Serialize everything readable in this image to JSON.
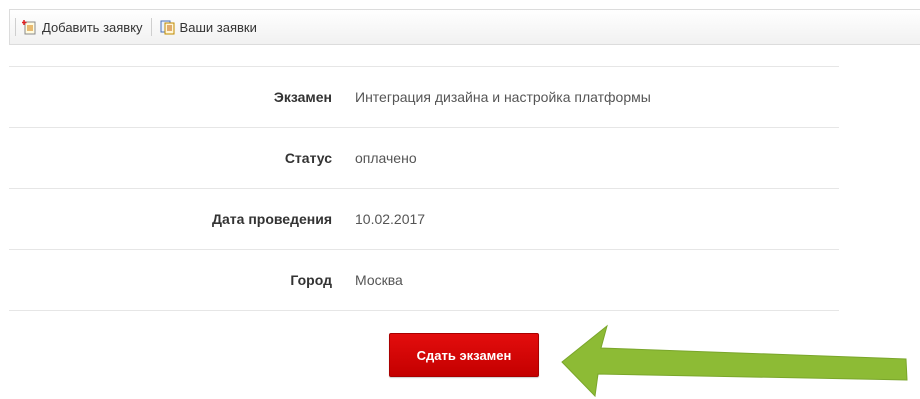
{
  "toolbar": {
    "add_request_label": "Добавить заявку",
    "your_requests_label": "Ваши заявки",
    "add_request_icon": "add-document-icon",
    "your_requests_icon": "document-list-icon"
  },
  "details": {
    "rows": [
      {
        "label": "Экзамен",
        "value": "Интеграция дизайна и настройка платформы"
      },
      {
        "label": "Статус",
        "value": "оплачено"
      },
      {
        "label": "Дата проведения",
        "value": "10.02.2017"
      },
      {
        "label": "Город",
        "value": "Москва"
      }
    ]
  },
  "actions": {
    "submit_label": "Сдать экзамен"
  },
  "colors": {
    "button": "#d40000",
    "arrow": "#8dbb35"
  },
  "annotation": {
    "icon": "arrow-left-icon"
  }
}
